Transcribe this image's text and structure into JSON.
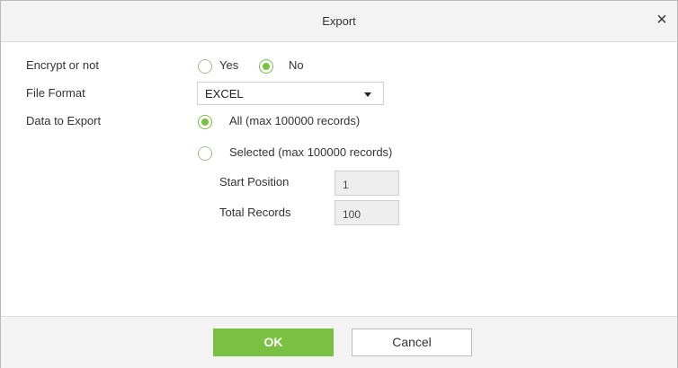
{
  "dialog": {
    "title": "Export",
    "close_symbol": "×"
  },
  "form": {
    "encrypt": {
      "label": "Encrypt or not",
      "yes_label": "Yes",
      "no_label": "No",
      "selected": "No"
    },
    "file_format": {
      "label": "File Format",
      "value": "EXCEL"
    },
    "data_to_export": {
      "label": "Data to Export",
      "all_label": "All (max 100000 records)",
      "selected_label": "Selected (max 100000 records)",
      "selected": "All"
    },
    "start_position": {
      "label": "Start Position",
      "value": "1"
    },
    "total_records": {
      "label": "Total Records",
      "value": "100"
    }
  },
  "footer": {
    "ok_label": "OK",
    "cancel_label": "Cancel"
  },
  "colors": {
    "accent": "#7ac143",
    "header_bg": "#f3f3f3"
  }
}
